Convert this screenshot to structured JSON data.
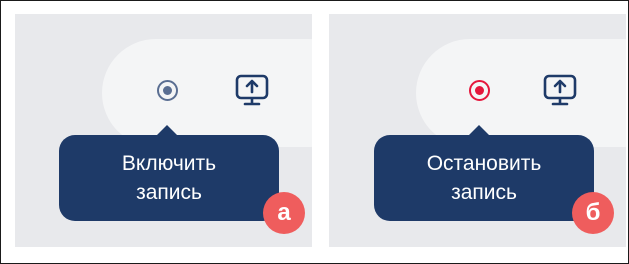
{
  "panels": {
    "a": {
      "record_icon": "record-inactive-icon",
      "record_color": "#5a6e92",
      "share_icon": "screen-share-icon",
      "tooltip_line1": "Включить",
      "tooltip_line2": "запись",
      "badge": "а"
    },
    "b": {
      "record_icon": "record-active-icon",
      "record_color": "#e5173c",
      "share_icon": "screen-share-icon",
      "tooltip_line1": "Остановить",
      "tooltip_line2": "запись",
      "badge": "б"
    }
  },
  "colors": {
    "tooltip_bg": "#1e3a68",
    "badge_bg": "#ef5d5d",
    "panel_bg": "#e8e9ec",
    "pill_bg": "#f4f5f6"
  }
}
